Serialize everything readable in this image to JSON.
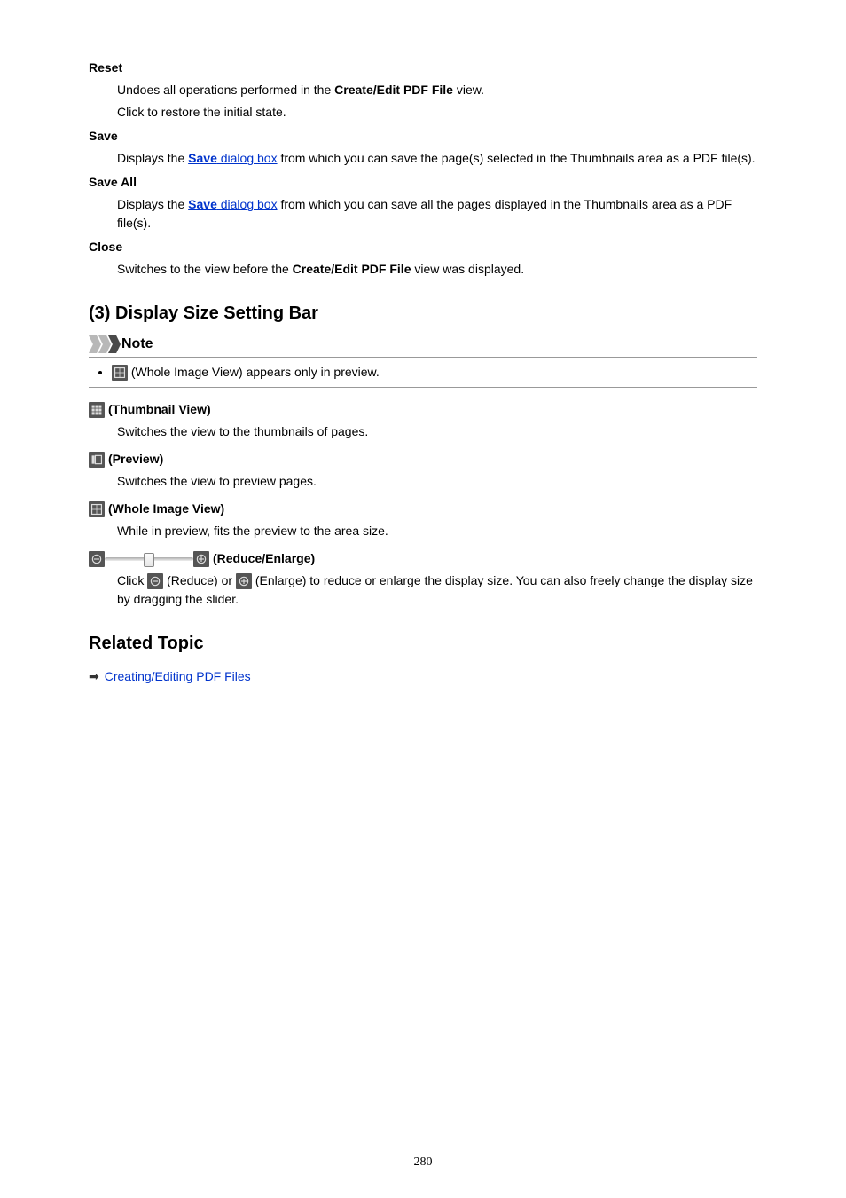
{
  "defs": {
    "reset": {
      "term": "Reset"
    },
    "save": {
      "term": "Save"
    },
    "saveall": {
      "term": "Save All"
    },
    "close": {
      "term": "Close"
    }
  },
  "section3": {
    "heading": "(3) Display Size Setting Bar",
    "note_label": "Note",
    "note_item": "(Whole Image View) appears only in preview.",
    "thumb": {
      "term": "(Thumbnail View)",
      "body": "Switches the view to the thumbnails of pages."
    },
    "preview": {
      "term": "(Preview)",
      "body": "Switches the view to preview pages."
    },
    "whole": {
      "term": "(Whole Image View)",
      "body": "While in preview, fits the preview to the area size."
    },
    "reduce": {
      "term": "(Reduce/Enlarge)"
    }
  },
  "related": {
    "heading": "Related Topic",
    "link": "Creating/Editing PDF Files"
  },
  "pagenum": "280",
  "bits": {
    "undoes_pre": "Undoes all operations performed in the ",
    "undoes_bold": "Create/Edit PDF File",
    "undoes_post": " view.",
    "click_restore": "Click to restore the initial state.",
    "displays_the": "Displays the ",
    "save_link_bold": "Save",
    "save_link_tail": " dialog box",
    "save_body_tail": " from which you can save the page(s) selected in the Thumbnails area as a PDF file(s).",
    "saveall_body_tail": " from which you can save all the pages displayed in the Thumbnails area as a PDF file(s).",
    "close_pre": "Switches to the view before the ",
    "close_bold": "Create/Edit PDF File",
    "close_post": " view was displayed.",
    "reduce_pre": "Click ",
    "reduce_mid1": " (Reduce) or ",
    "reduce_mid2": " (Enlarge) to reduce or enlarge the display size. You can also freely change the display size by dragging the slider."
  }
}
